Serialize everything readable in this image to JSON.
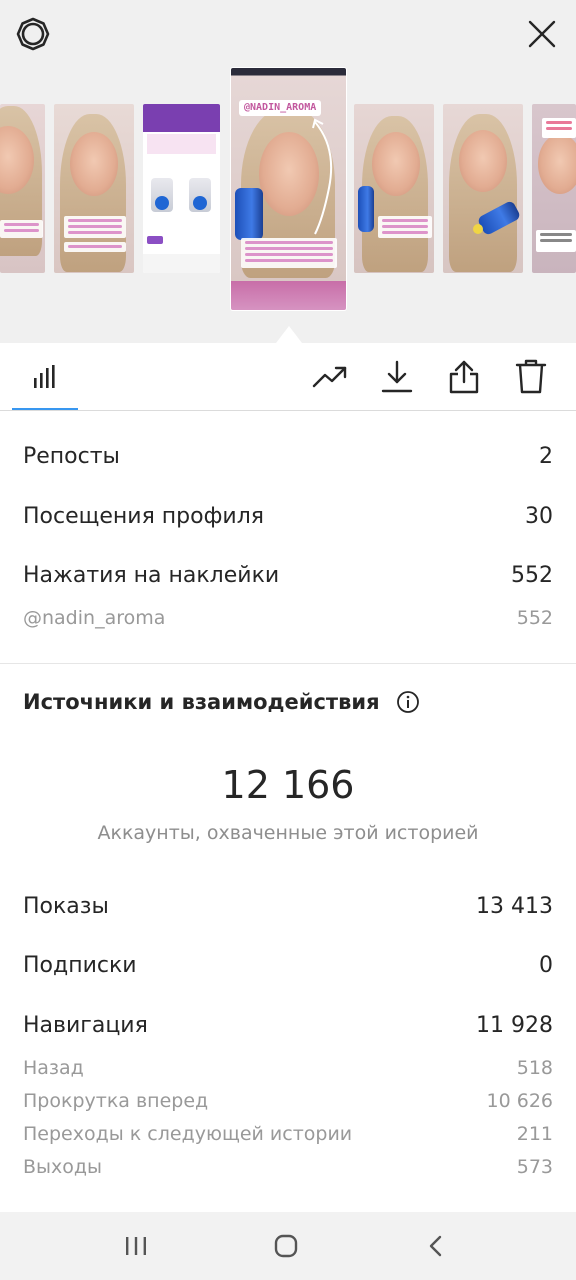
{
  "header": {
    "settings_icon": "settings-gear-icon",
    "close_icon": "close-icon"
  },
  "stories": {
    "selected_mention": "@NADIN_AROMA",
    "thumbnails": [
      {
        "id": "story-1"
      },
      {
        "id": "story-2"
      },
      {
        "id": "story-3"
      },
      {
        "id": "story-4"
      },
      {
        "id": "story-5"
      },
      {
        "id": "story-6"
      },
      {
        "id": "story-7"
      }
    ]
  },
  "toolbar": {
    "icons": [
      "bar-chart-icon",
      "trending-up-icon",
      "download-icon",
      "share-icon",
      "trash-icon"
    ],
    "accent": "#3897f0"
  },
  "metrics": {
    "reposts": {
      "label": "Репосты",
      "value": "2"
    },
    "profile_visits": {
      "label": "Посещения профиля",
      "value": "30"
    },
    "sticker_taps": {
      "label": "Нажатия на наклейки",
      "value": "552"
    },
    "mention": {
      "label": "@nadin_aroma",
      "value": "552"
    }
  },
  "sources": {
    "title": "Источники и взаимодействия",
    "reach_value": "12 166",
    "reach_caption": "Аккаунты, охваченные этой историей",
    "impressions": {
      "label": "Показы",
      "value": "13 413"
    },
    "follows": {
      "label": "Подписки",
      "value": "0"
    },
    "navigation": {
      "label": "Навигация",
      "value": "11 928"
    },
    "back": {
      "label": "Назад",
      "value": "518"
    },
    "forward": {
      "label": "Прокрутка вперед",
      "value": "10 626"
    },
    "next_story": {
      "label": "Переходы к следующей истории",
      "value": "211"
    },
    "exits": {
      "label": "Выходы",
      "value": "573"
    }
  },
  "system_nav": {
    "icons": [
      "recent-apps-icon",
      "home-icon",
      "back-icon"
    ]
  }
}
